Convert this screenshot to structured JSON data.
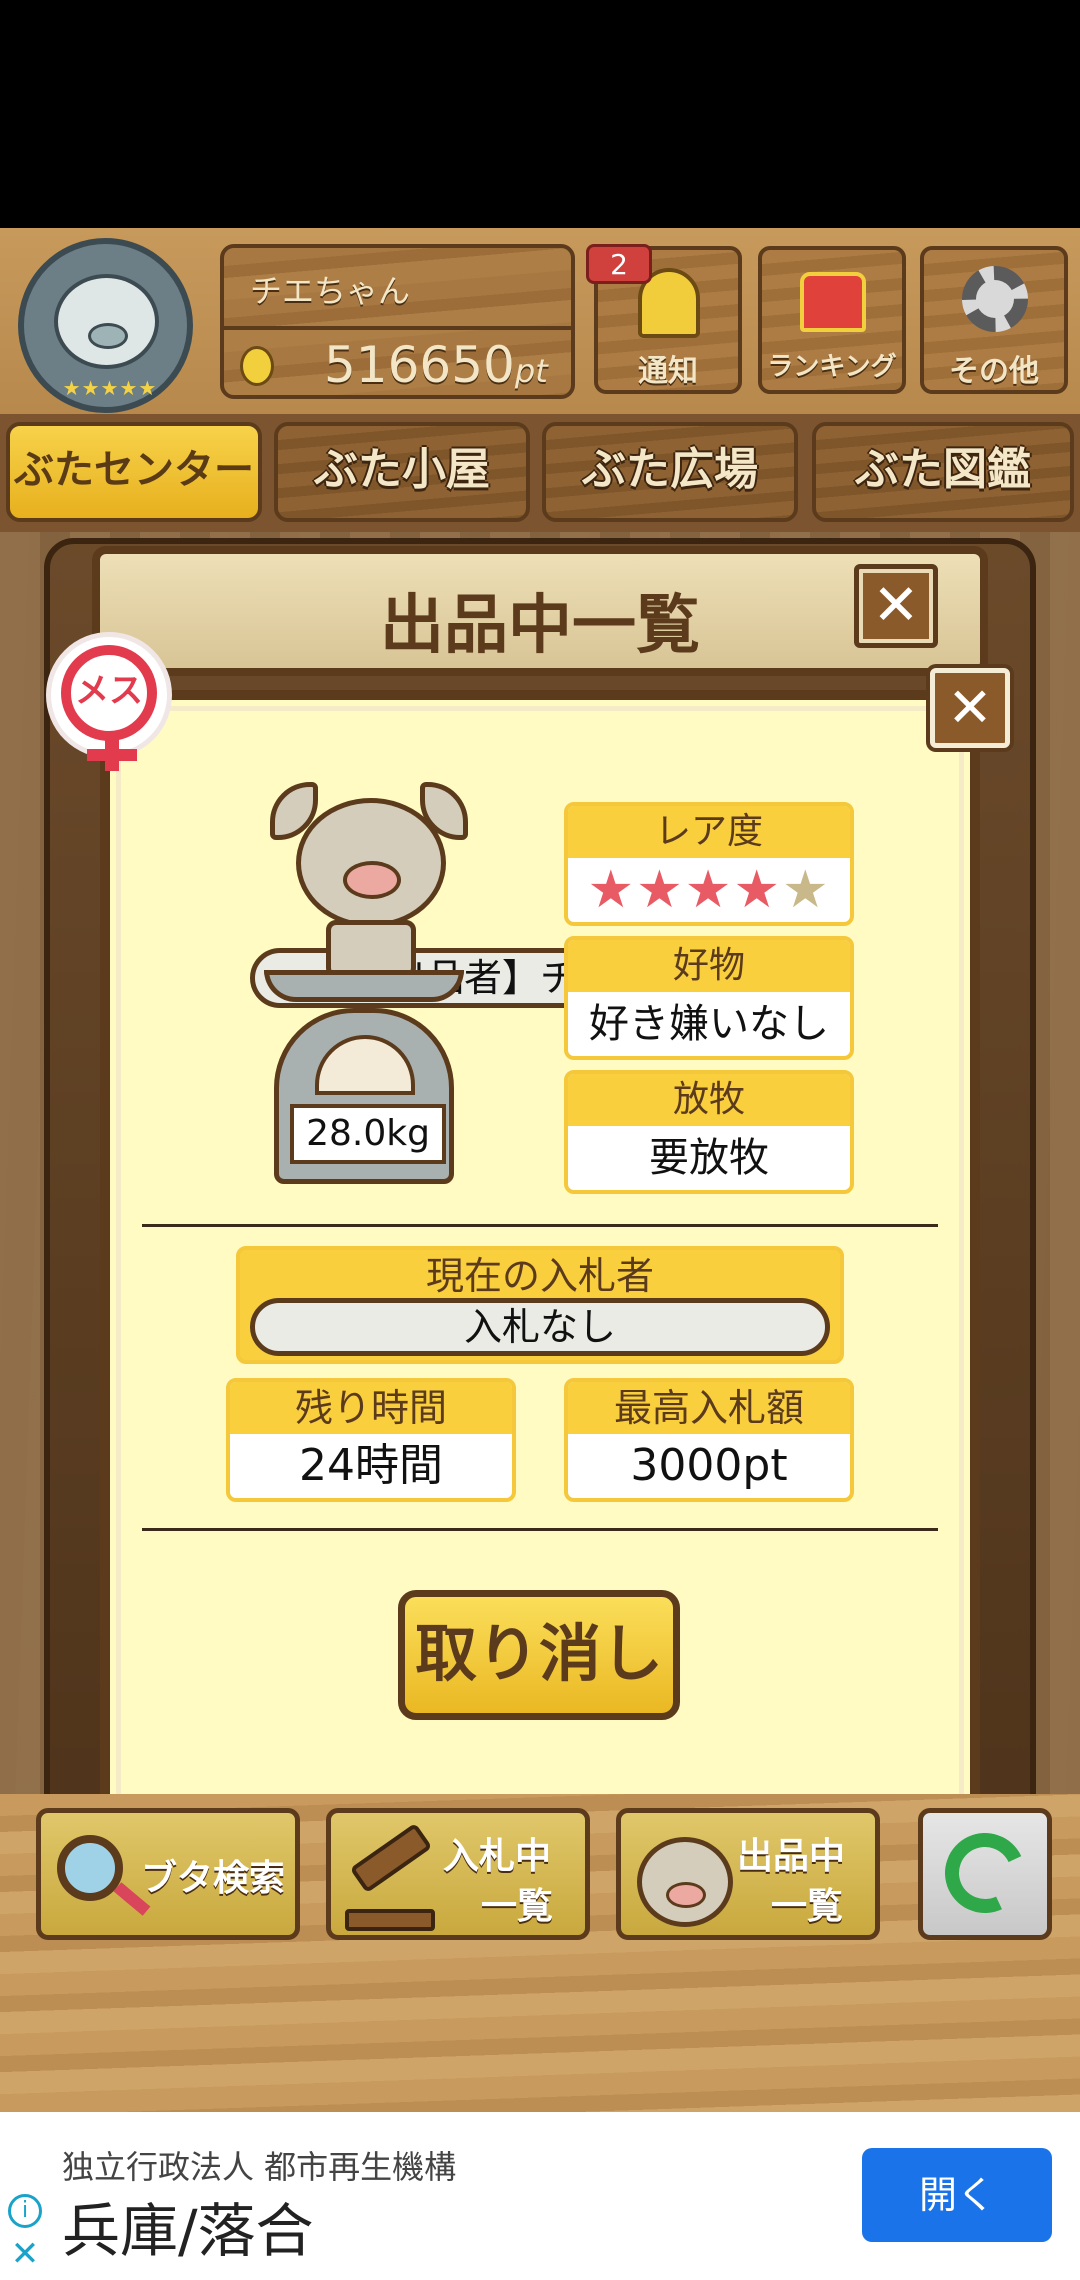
{
  "header": {
    "player_name": "チエちゃん",
    "points": "516650",
    "points_unit": "pt",
    "notification_count": "2",
    "buttons": {
      "notify": "通知",
      "ranking": "ランキング",
      "other": "その他"
    }
  },
  "tabs": [
    {
      "label": "ぶたセンター",
      "active": true
    },
    {
      "label": "ぶた小屋",
      "active": false
    },
    {
      "label": "ぶた広場",
      "active": false
    },
    {
      "label": "ぶた図鑑",
      "active": false
    }
  ],
  "dialog": {
    "title": "出品中一覧",
    "gender_badge": "メス",
    "seller": "【出品者】チエちゃん",
    "weight": "28.0kg",
    "rarity": {
      "label": "レア度",
      "stars_filled": 4,
      "stars_total": 5,
      "star_glyph": "★"
    },
    "favorite": {
      "label": "好物",
      "value": "好き嫌いなし"
    },
    "grazing": {
      "label": "放牧",
      "value": "要放牧"
    },
    "current_bidder": {
      "label": "現在の入札者",
      "value": "入札なし"
    },
    "time_left": {
      "label": "残り時間",
      "value": "24時間"
    },
    "highest_bid": {
      "label": "最高入札額",
      "value": "3000pt"
    },
    "cancel_button": "取り消し",
    "close_glyph": "✕"
  },
  "bottom_bar": {
    "search": "ブタ検索",
    "bidding_line1": "入札中",
    "bidding_line2": "一覧",
    "listing_line1": "出品中",
    "listing_line2": "一覧"
  },
  "ad": {
    "advertiser": "独立行政法人 都市再生機構",
    "headline": "兵庫/落合",
    "open_button": "開く"
  },
  "colors": {
    "accent_yellow": "#f9cf3e",
    "wood_dark": "#5b3b1c",
    "panel_bg": "#fffbc2",
    "star_filled": "#e85b64",
    "star_empty": "#c9b98a",
    "ad_button": "#1a73e8",
    "female_badge": "#e23b4e"
  }
}
